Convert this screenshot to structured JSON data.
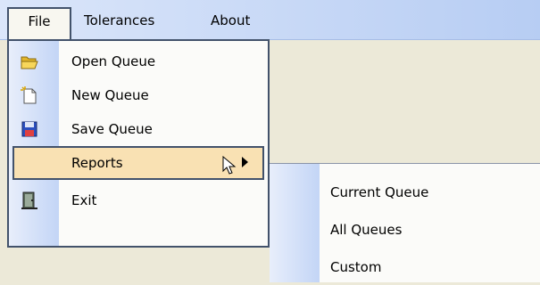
{
  "menubar": {
    "file": "File",
    "tolerances": "Tolerances",
    "about": "About"
  },
  "file_menu": {
    "items": [
      {
        "label": "Open Queue",
        "icon": "folder-open-icon"
      },
      {
        "label": "New Queue",
        "icon": "new-document-icon"
      },
      {
        "label": "Save Queue",
        "icon": "floppy-disk-icon"
      },
      {
        "label": "Reports",
        "icon": ""
      },
      {
        "label": "Exit",
        "icon": "exit-door-icon"
      }
    ]
  },
  "reports_submenu": {
    "items": [
      {
        "label": "Current Queue"
      },
      {
        "label": "All Queues"
      },
      {
        "label": "Custom"
      }
    ]
  },
  "colors": {
    "menubar_gradient_start": "#dbe6fa",
    "menubar_gradient_end": "#b7cdf3",
    "highlight": "#f9e1b3",
    "border": "#42526b",
    "workspace": "#ece9d8"
  }
}
